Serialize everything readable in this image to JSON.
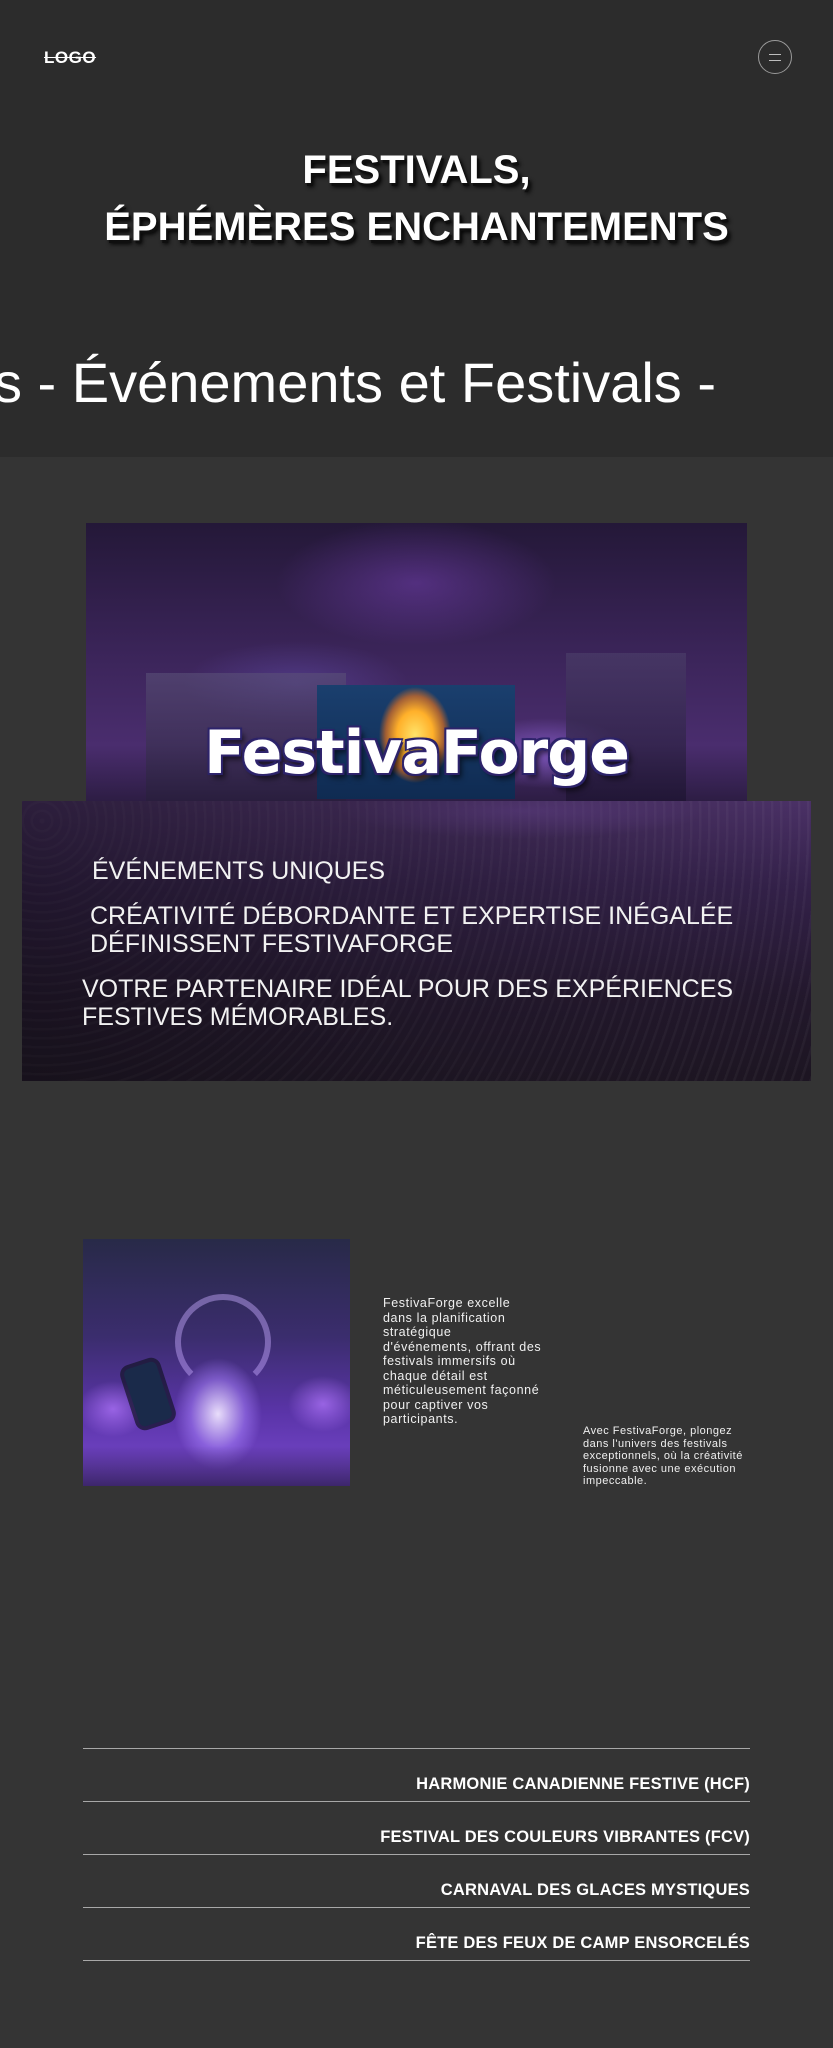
{
  "header": {
    "logo": "LOGO",
    "menu_icon": "hamburger-menu-icon"
  },
  "hero": {
    "title_line1": "FESTIVALS,",
    "title_line2": "ÉPHÉMÈRES ENCHANTEMENTS"
  },
  "marquee": {
    "text": "s -  Événements et Festivals -"
  },
  "banner": {
    "brand": "FestivaForge",
    "line1": "ÉVÉNEMENTS UNIQUES",
    "line2a": "CRÉATIVITÉ DÉBORDANTE ET EXPERTISE INÉGALÉE",
    "line2b": "DÉFINISSENT FESTIVAFORGE",
    "line3a": "VOTRE PARTENAIRE IDÉAL POUR DES EXPÉRIENCES",
    "line3b": "FESTIVES MÉMORABLES."
  },
  "about": {
    "paragraph1": "FestivaForge excelle dans la planification stratégique d'événements, offrant des festivals immersifs où chaque détail est méticuleusement façonné pour captiver vos participants.",
    "paragraph2": "Avec FestivaForge, plongez dans l'univers des festivals exceptionnels, où la créativité fusionne avec une exécution impeccable."
  },
  "festivals": [
    "HARMONIE CANADIENNE FESTIVE (HCF)",
    "FESTIVAL DES COULEURS VIBRANTES (FCV)",
    "CARNAVAL DES GLACES MYSTIQUES",
    "FÊTE DES FEUX DE CAMP ENSORCELÉS"
  ]
}
